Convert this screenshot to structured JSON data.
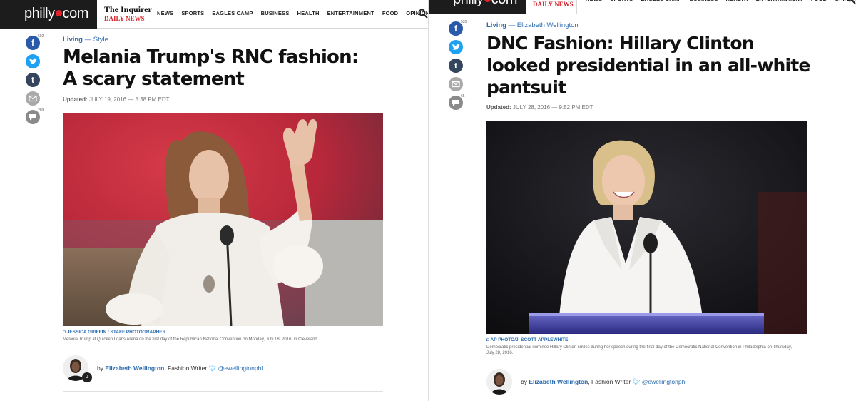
{
  "header": {
    "logo_left": "philly",
    "logo_right": "com",
    "brand_inquirer": "The Inquirer",
    "brand_daily": "DAILY NEWS",
    "nav": [
      "NEWS",
      "SPORTS",
      "EAGLES CAMP",
      "BUSINESS",
      "HEALTH",
      "ENTERTAINMENT",
      "FOOD",
      "OPINION"
    ],
    "nav_clipped": "OI"
  },
  "left": {
    "share": {
      "facebook_count": "692",
      "comments_count": "289"
    },
    "section_main": "Living",
    "section_sep": "—",
    "section_sub": "Style",
    "headline": "Melania Trump's RNC fashion: A scary statement",
    "updated_label": "Updated:",
    "updated_value": "JULY 19, 2016 — 5:38 PM EDT",
    "credit": "JESSICA GRIFFIN / STAFF PHOTOGRAPHER",
    "caption": "Melania Trump at Quicken Loans Arena on the first day of the Republican National Convention on Monday, July 18, 2016, in Cleveland.",
    "byline_prefix": "by",
    "author": "Elizabeth Wellington",
    "author_role": ", Fashion Writer",
    "twitter": "@ewellingtonphl"
  },
  "right": {
    "share": {
      "facebook_count": "535",
      "comments_count": "65"
    },
    "section_main": "Living",
    "section_sep": "—",
    "section_sub": "Elizabeth Wellington",
    "headline": "DNC Fashion: Hillary Clinton looked presidential in an all-white pantsuit",
    "updated_label": "Updated:",
    "updated_value": "JULY 28, 2016 — 9:52 PM EDT",
    "credit": "AP PHOTO/J. SCOTT APPLEWHITE",
    "caption": "Democratic presidential nominee Hillary Clinton smiles during her speech during the final day of the Democratic National Convention in Philadelphia on Thursday, July 28, 2016.",
    "byline_prefix": "by",
    "author": "Elizabeth Wellington",
    "author_role": ", Fashion Writer",
    "twitter": "@ewellingtonphl"
  },
  "colors": {
    "link_blue": "#2b6cb0",
    "facebook": "#2b5ba8",
    "twitter": "#1da1f2",
    "tumblr": "#34465d",
    "logo_red": "#e0242c"
  },
  "icons": [
    "facebook-icon",
    "twitter-icon",
    "tumblr-icon",
    "email-icon",
    "comment-icon",
    "search-icon",
    "twitter-bird-icon"
  ]
}
